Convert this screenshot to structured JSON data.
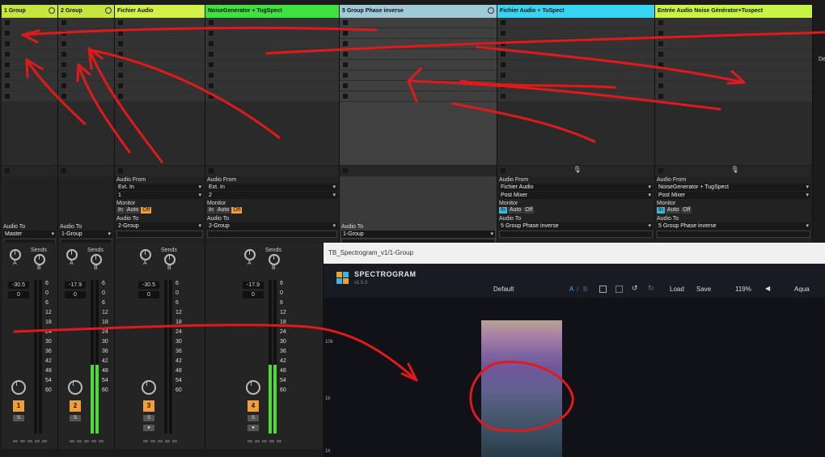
{
  "tracks": [
    {
      "name": "1 Group",
      "color": "#c8e53d",
      "group": true,
      "audio_to_label": "Audio To",
      "audio_to": "Master",
      "number": "1",
      "vol": "-30.5",
      "pan": "0",
      "meter": 0
    },
    {
      "name": "2 Group",
      "color": "#c8e53d",
      "group": true,
      "audio_to_label": "Audio To",
      "audio_to": "1-Group",
      "number": "2",
      "vol": "-17.9",
      "pan": "0",
      "meter": 0.45
    },
    {
      "name": "Fichier Audio",
      "color": "#d3f047",
      "audio_from_label": "Audio From",
      "audio_from": "Ext. In",
      "audio_from2": "1",
      "monitor_label": "Monitor",
      "audio_to_label": "Audio To",
      "audio_to": "2-Group",
      "number": "3",
      "vol": "-30.5",
      "pan": "0",
      "meter": 0
    },
    {
      "name": "NoiseGenerator + TugSpect",
      "color": "#3ee23e",
      "audio_from_label": "Audio From",
      "audio_from": "Ext. In",
      "audio_from2": "2",
      "monitor_label": "Monitor",
      "audio_to_label": "Audio To",
      "audio_to": "2-Group",
      "number": "4",
      "vol": "-17.9",
      "pan": "0",
      "meter": 0.45
    },
    {
      "name": "5 Group Phase inverse",
      "color": "#9fcad6",
      "group": true,
      "audio_to_label": "Audio To",
      "audio_to": "1-Group"
    },
    {
      "name": "Fichier Audio + TuSpect",
      "color": "#38d5f2",
      "audio_from_label": "Audio From",
      "audio_from": "Fichier Audio",
      "audio_from2": "Post Mixer",
      "monitor_label": "Monitor",
      "audio_to_label": "Audio To",
      "audio_to": "5 Group Phase inverse"
    },
    {
      "name": "Entrée Audio Noise Générator+Tuspect",
      "color": "#c8f542",
      "audio_from_label": "Audio From",
      "audio_from": "NoiseGenerator + TugSpect",
      "audio_from2": "Post Mixer",
      "monitor_label": "Monitor",
      "audio_to_label": "Audio To",
      "audio_to": "5 Group Phase inverse"
    }
  ],
  "monitor": {
    "in": "In",
    "auto": "Auto",
    "off": "Off"
  },
  "sends_label": "Sends",
  "send_a": "A",
  "send_b": "B",
  "solo": "S",
  "db_ticks": [
    "6",
    "0",
    "6",
    "12",
    "18",
    "24",
    "30",
    "36",
    "42",
    "48",
    "54",
    "60"
  ],
  "side_label": "De",
  "plugin": {
    "window_title": "TB_Spectrogram_v1/1-Group",
    "brand": "SPECTROGRAM",
    "version": "v1.5.3",
    "preset": "Default",
    "ab_a": "A",
    "ab_sep": "/",
    "ab_b": "B",
    "load": "Load",
    "save": "Save",
    "zoom": "119%",
    "theme": "Aqua",
    "freq_labels": [
      "10k",
      "1k",
      "1k"
    ]
  }
}
